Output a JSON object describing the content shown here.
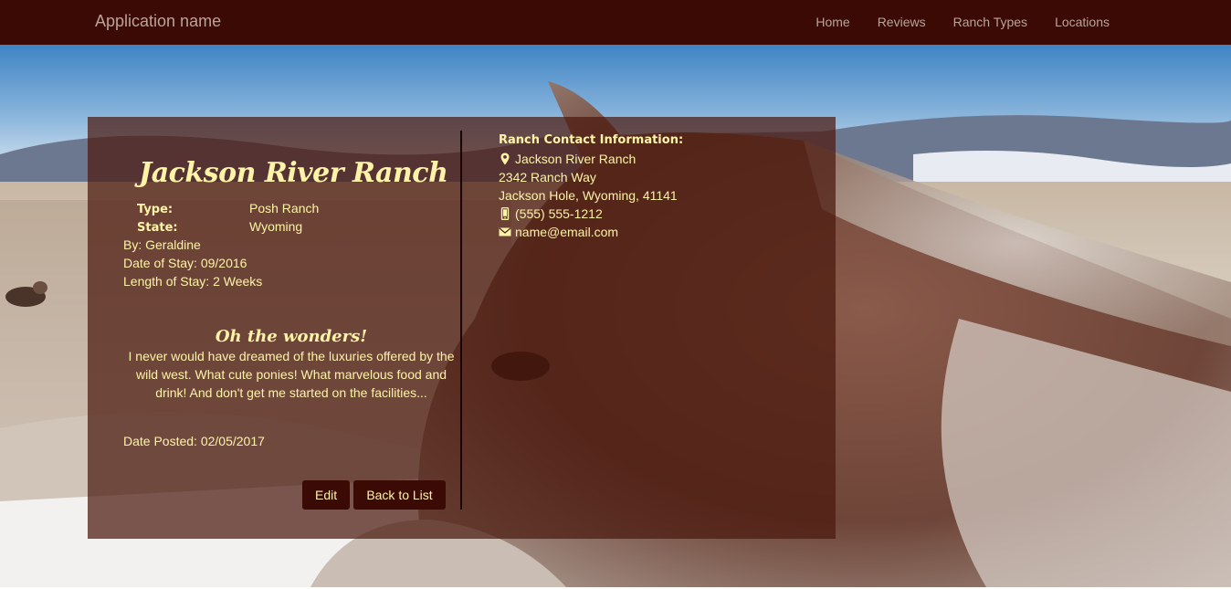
{
  "nav": {
    "brand": "Application name",
    "links": [
      "Home",
      "Reviews",
      "Ranch Types",
      "Locations"
    ]
  },
  "review": {
    "ranch_name": "Jackson River Ranch",
    "type_label": "Type:",
    "type_value": "Posh Ranch",
    "state_label": "State:",
    "state_value": "Wyoming",
    "by": "By: Geraldine",
    "date_of_stay": "Date of Stay: 09/2016",
    "length_of_stay": "Length of Stay: 2 Weeks",
    "headline": "Oh the wonders!",
    "body": "I never would have dreamed of the luxuries offered by the wild west. What cute ponies! What marvelous food and drink! And don't get me started on the facilities...",
    "date_posted": "Date Posted: 02/05/2017",
    "edit_label": "Edit",
    "back_label": "Back to List"
  },
  "contact": {
    "heading": "Ranch Contact Information:",
    "name": "Jackson River Ranch",
    "street": "2342 Ranch Way",
    "city_line": "Jackson Hole, Wyoming, 41141",
    "phone": "(555) 555-1212",
    "email": "name@email.com",
    "icons": [
      "map-marker-icon",
      "phone-icon",
      "envelope-icon"
    ]
  },
  "colors": {
    "navbar": "#3c0a04",
    "accent_text": "#fff3a8",
    "panel": "#4b190e"
  }
}
